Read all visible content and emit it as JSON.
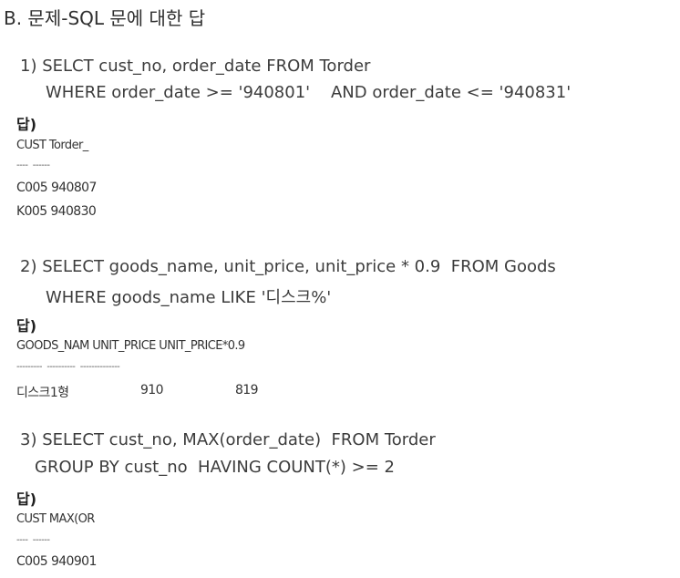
{
  "title": "B. 문제-SQL 문에 대한 답",
  "problems": [
    {
      "sql_line1": "1) SELCT cust_no, order_date FROM Torder",
      "sql_line2": "WHERE order_date >= '940801'    AND order_date <= '940831'",
      "answer_label": "답)",
      "result_header": "CUST Torder_",
      "dash_line": "----  ------",
      "rows": [
        "C005 940807",
        "K005 940830"
      ]
    },
    {
      "sql_line1": "2) SELECT goods_name, unit_price, unit_price * 0.9  FROM Goods",
      "sql_line2": "WHERE goods_name LIKE '디스크%'",
      "answer_label": "답)",
      "result_header": "GOODS_NAM UNIT_PRICE UNIT_PRICE*0.9",
      "dash_line": "---------  ----------  --------------",
      "rows": [
        {
          "name": "디스크1형",
          "price": "910",
          "discount": "819"
        }
      ]
    },
    {
      "sql_line1": "3) SELECT cust_no, MAX(order_date)  FROM Torder",
      "sql_line2": "GROUP BY cust_no  HAVING COUNT(*) >= 2",
      "answer_label": "답)",
      "result_header": "CUST MAX(OR",
      "dash_line": "----  ------",
      "rows": [
        "C005 940901"
      ]
    }
  ]
}
